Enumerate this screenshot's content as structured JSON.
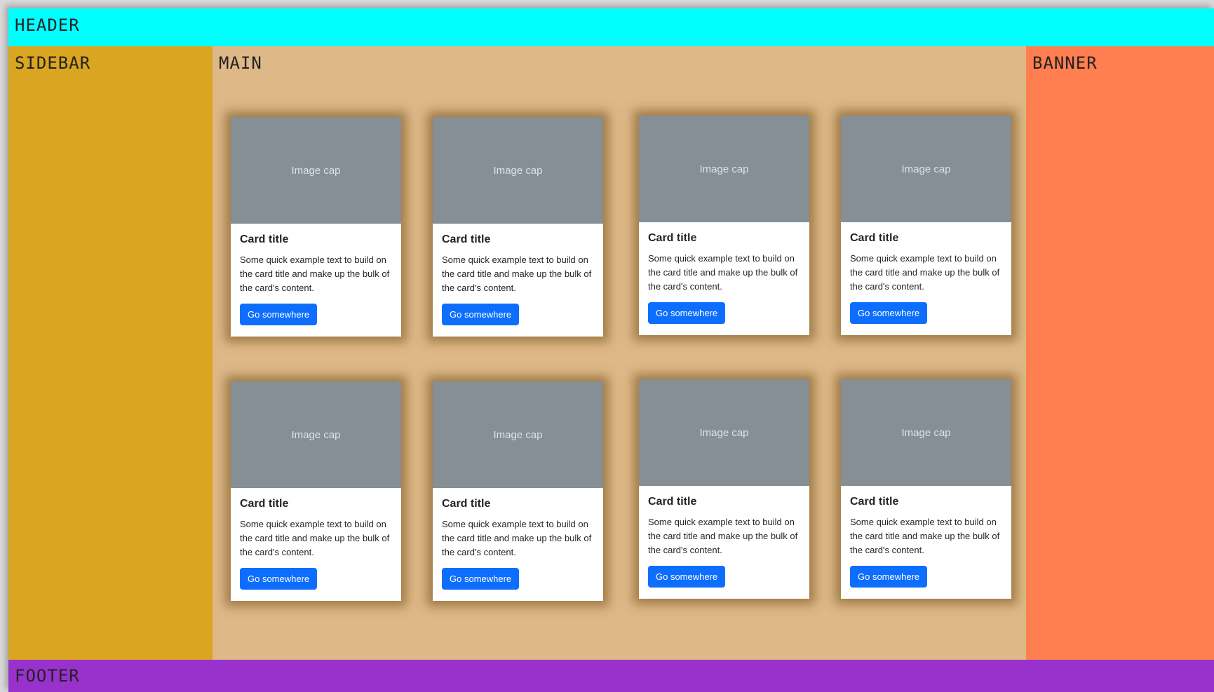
{
  "layout": {
    "header_label": "HEADER",
    "sidebar_label": "SIDEBAR",
    "main_label": "MAIN",
    "banner_label": "BANNER",
    "footer_label": "FOOTER"
  },
  "colors": {
    "header": "#00ffff",
    "sidebar": "#daa520",
    "main": "#deb887",
    "banner": "#ff7f50",
    "footer": "#9932cc",
    "button": "#0d6efd",
    "image_cap": "#868e96"
  },
  "cards": [
    {
      "image": "Image cap",
      "title": "Card title",
      "text": "Some quick example text to build on the card title and make up the bulk of the card's content.",
      "button": "Go somewhere"
    },
    {
      "image": "Image cap",
      "title": "Card title",
      "text": "Some quick example text to build on the card title and make up the bulk of the card's content.",
      "button": "Go somewhere"
    },
    {
      "image": "Image cap",
      "title": "Card title",
      "text": "Some quick example text to build on the card title and make up the bulk of the card's content.",
      "button": "Go somewhere"
    },
    {
      "image": "Image cap",
      "title": "Card title",
      "text": "Some quick example text to build on the card title and make up the bulk of the card's content.",
      "button": "Go somewhere"
    },
    {
      "image": "Image cap",
      "title": "Card title",
      "text": "Some quick example text to build on the card title and make up the bulk of the card's content.",
      "button": "Go somewhere"
    },
    {
      "image": "Image cap",
      "title": "Card title",
      "text": "Some quick example text to build on the card title and make up the bulk of the card's content.",
      "button": "Go somewhere"
    },
    {
      "image": "Image cap",
      "title": "Card title",
      "text": "Some quick example text to build on the card title and make up the bulk of the card's content.",
      "button": "Go somewhere"
    },
    {
      "image": "Image cap",
      "title": "Card title",
      "text": "Some quick example text to build on the card title and make up the bulk of the card's content.",
      "button": "Go somewhere"
    }
  ]
}
